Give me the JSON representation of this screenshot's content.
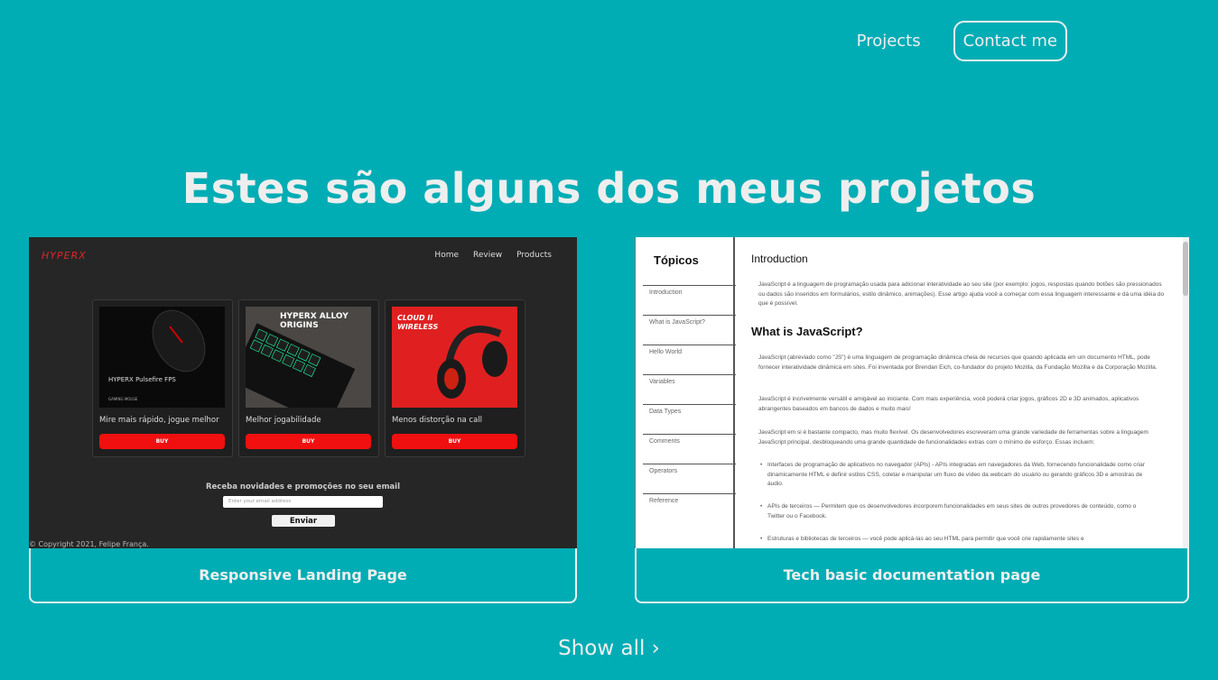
{
  "nav": {
    "projects": "Projects",
    "contact": "Contact me"
  },
  "heading": "Estes são alguns dos meus projetos",
  "projects": [
    {
      "caption": "Responsive Landing Page",
      "thumb": {
        "logo": "HYPERX",
        "nav": [
          "Home",
          "Review",
          "Products"
        ],
        "products": [
          {
            "name": "Mire mais rápido, jogue melhor",
            "buy": "BUY",
            "img_text": "HYPERX Pulsefire FPS",
            "img_sub": "GAMING MOUSE"
          },
          {
            "name": "Melhor jogabilidade",
            "buy": "BUY",
            "img_text": "HYPERX ALLOY ORIGINS"
          },
          {
            "name": "Menos distorção na call",
            "buy": "BUY",
            "img_text": "CLOUD II WIRELESS"
          }
        ],
        "newsletter": "Receba novidades e promoções no seu email",
        "email_placeholder": "Enter your email address",
        "send": "Enviar",
        "copyright": "© Copyright 2021, Felipe França."
      }
    },
    {
      "caption": "Tech basic documentation page",
      "thumb": {
        "sidebar_title": "Tópicos",
        "sidebar_items": [
          "Introduction",
          "What is JavaScript?",
          "Hello World",
          "Variables",
          "Data Types",
          "Comments",
          "Operators",
          "Reference"
        ],
        "h_intro": "Introduction",
        "p_intro": "JavaScript é a linguagem de programação usada para adicionar interatividade ao seu site (por exemplo: jogos, respostas quando botões são pressionados ou dados são inseridos em formulários, estilo dinâmico, animações). Esse artigo ajuda você a começar com essa linguagem interessante e dá uma idéia do que é possível.",
        "h_what": "What is JavaScript?",
        "p1": "JavaScript (abreviado como \"JS\") é uma linguagem de programação dinâmica cheia de recursos que quando aplicada em um documento HTML, pode fornecer interatividade dinâmica em sites. Foi inventada por Brendan Eich, co-fundador do projeto Mozilla, da Fundação Mozilla e da Corporação Mozilla.",
        "p2": "JavaScript é incrivelmente versátil e amigável ao iniciante. Com mais experiência, você poderá criar jogos, gráficos 2D e 3D animados, aplicativos abrangentes baseados em bancos de dados e muito mais!",
        "p3": "JavaScript em si é bastante compacto, mas muito flexível. Os desenvolvedores escreveram uma grande variedade de ferramentas sobre a linguagem JavaScript principal, desbloqueando uma grande quantidade de funcionalidades extras com o mínimo de esforço. Essas incluem:",
        "b1": "Interfaces de programação de aplicativos no navegador (APIs) - APIs integradas em navegadores da Web, fornecendo funcionalidade como criar dinamicamente HTML e definir estilos CSS, coletar e manipular um fluxo de vídeo da webcam do usuário ou gerando gráficos 3D e amostras de áudio.",
        "b2": "APIs de terceiros — Permitem que os desenvolvedores incorporem funcionalidades em seus sites de outros provedores de conteúdo, como o Twitter ou o Facebook.",
        "b3": "Estruturas e bibliotecas de terceiros — você pode aplicá-las ao seu HTML para permitir que você crie rapidamente sites e"
      }
    }
  ],
  "show_all": "Show all",
  "colors": {
    "background": "#00adb5",
    "text": "#eeeeee",
    "buy_red": "#f01010"
  }
}
